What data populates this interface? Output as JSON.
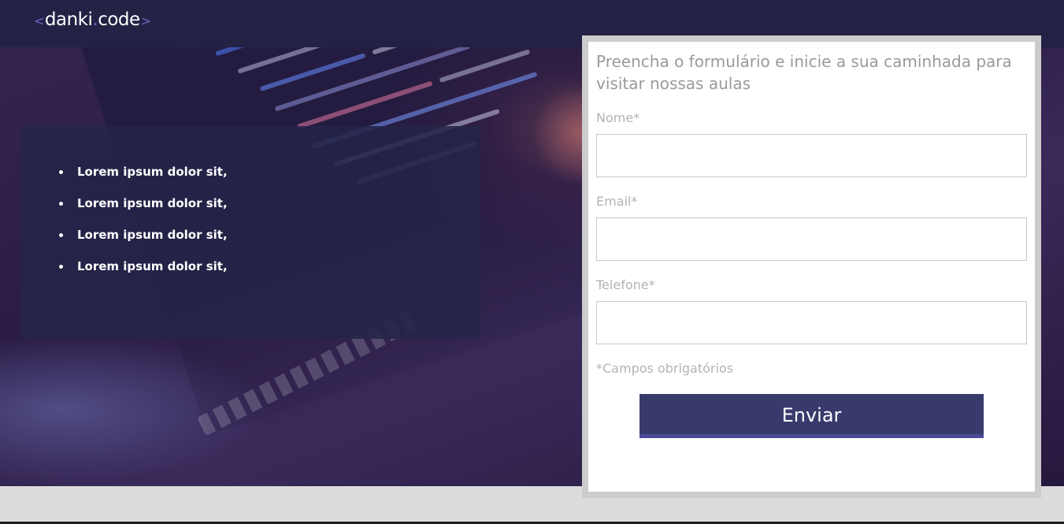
{
  "header": {
    "logo": {
      "open_bracket": "<",
      "name_part1": "danki",
      "dot": ".",
      "name_part2": "code",
      "close_bracket": ">"
    }
  },
  "features": {
    "items": [
      "Lorem ipsum dolor sit,",
      "Lorem ipsum dolor sit,",
      "Lorem ipsum dolor sit,",
      "Lorem ipsum dolor sit,"
    ]
  },
  "form": {
    "title": "Preencha o formulário e inicie a sua caminhada para visitar nossas aulas",
    "fields": [
      {
        "label": "Nome*",
        "value": ""
      },
      {
        "label": "Email*",
        "value": ""
      },
      {
        "label": "Telefone*",
        "value": ""
      }
    ],
    "required_note": "*Campos obrigatórios",
    "submit_label": "Enviar"
  },
  "colors": {
    "header_bg": "#232245",
    "accent": "#6d67c8",
    "button_bg": "#393a6c",
    "button_border": "#4b4a97",
    "features_bg": "#242448"
  }
}
